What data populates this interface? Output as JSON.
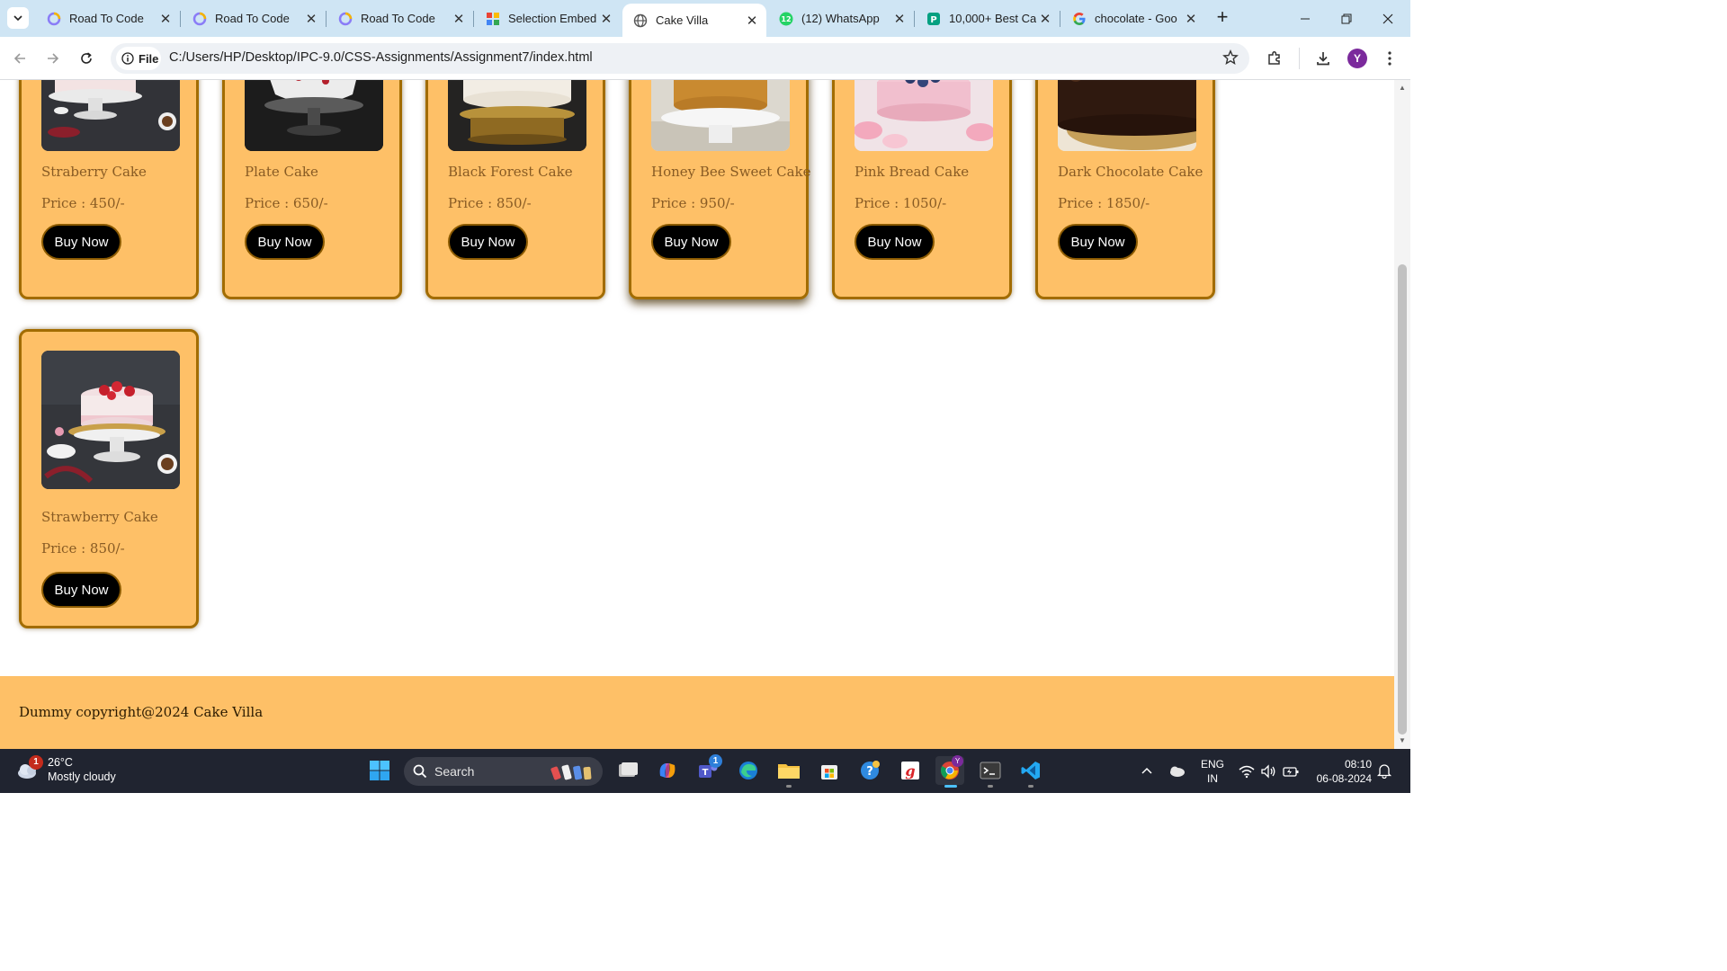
{
  "browser": {
    "tabs": [
      {
        "title": "Road To Code",
        "icon": "road-to-code-favicon"
      },
      {
        "title": "Road To Code",
        "icon": "road-to-code-favicon"
      },
      {
        "title": "Road To Code",
        "icon": "road-to-code-favicon"
      },
      {
        "title": "Selection Embed",
        "icon": "colorful-grid-favicon"
      },
      {
        "title": "Cake Villa",
        "icon": "globe-favicon",
        "active": true
      },
      {
        "title": "(12) WhatsApp",
        "icon": "whatsapp-favicon",
        "badge": "12"
      },
      {
        "title": "10,000+ Best Ca",
        "icon": "pexels-favicon"
      },
      {
        "title": "chocolate - Goo",
        "icon": "google-favicon"
      }
    ],
    "address": {
      "chip_label": "File",
      "url": "C:/Users/HP/Desktop/IPC-9.0/CSS-Assignments/Assignment7/index.html"
    },
    "profile_initial": "Y",
    "accent": "#cfe5f4"
  },
  "page": {
    "top_row": [
      {
        "name": "Straberry Cake",
        "price": "Price : 450/-",
        "button": "Buy Now",
        "image": "strawberry-cake"
      },
      {
        "name": "Plate Cake",
        "price": "Price : 650/-",
        "button": "Buy Now",
        "image": "white-cake-stand"
      },
      {
        "name": "Black Forest Cake",
        "price": "Price : 850/-",
        "button": "Buy Now",
        "image": "black-forest-cake"
      },
      {
        "name": "Honey Bee Sweet Cake",
        "price": "Price : 950/-",
        "button": "Buy Now",
        "image": "honey-cake"
      },
      {
        "name": "Pink Bread Cake",
        "price": "Price : 1050/-",
        "button": "Buy Now",
        "image": "pink-blueberry-cake"
      },
      {
        "name": "Dark Chocolate Cake",
        "price": "Price : 1850/-",
        "button": "Buy Now",
        "image": "chocolate-cake"
      }
    ],
    "second_row": [
      {
        "name": "Strawberry Cake",
        "price": "Price : 850/-",
        "button": "Buy Now",
        "image": "strawberry-cake"
      }
    ],
    "footer": "Dummy copyright@2024 Cake Villa",
    "colors": {
      "card_bg": "#fec067",
      "card_border": "#a26c00",
      "text": "#885b24",
      "button": "#000000"
    }
  },
  "taskbar": {
    "weather": {
      "temp": "26°C",
      "condition": "Mostly cloudy",
      "badge": "1"
    },
    "search_placeholder": "Search",
    "lang": {
      "line1": "ENG",
      "line2": "IN"
    },
    "clock": {
      "time": "08:10",
      "date": "06-08-2024"
    },
    "teams_badge": "1"
  }
}
